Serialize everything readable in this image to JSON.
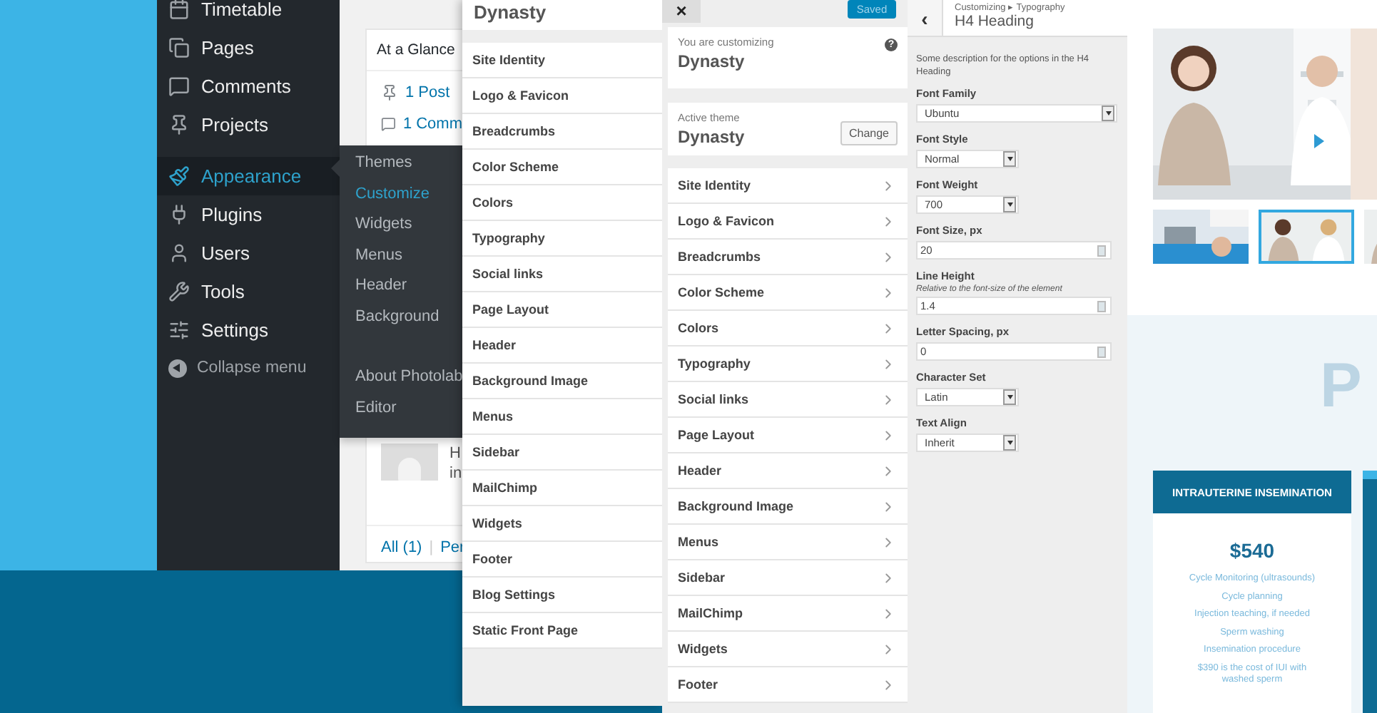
{
  "admin_menu": {
    "items": [
      {
        "label": "Timetable",
        "selected": false
      },
      {
        "label": "Pages",
        "selected": false
      },
      {
        "label": "Comments",
        "selected": false
      },
      {
        "label": "Projects",
        "selected": false
      },
      {
        "label": "Appearance",
        "selected": true
      },
      {
        "label": "Plugins",
        "selected": false
      },
      {
        "label": "Users",
        "selected": false
      },
      {
        "label": "Tools",
        "selected": false
      },
      {
        "label": "Settings",
        "selected": false
      }
    ],
    "collapse": "Collapse menu"
  },
  "submenu": {
    "items": [
      {
        "label": "Themes",
        "selected": false
      },
      {
        "label": "Customize",
        "selected": true
      },
      {
        "label": "Widgets",
        "selected": false
      },
      {
        "label": "Menus",
        "selected": false
      },
      {
        "label": "Header",
        "selected": false
      },
      {
        "label": "Background",
        "selected": false
      },
      {
        "label": "About Photolab",
        "selected": false
      },
      {
        "label": "Editor",
        "selected": false
      }
    ]
  },
  "dashboard": {
    "widget_title": "At a Glance",
    "stats": [
      "1 Post",
      "1 Comm"
    ],
    "comment_lines": [
      "H",
      "in"
    ],
    "filters": [
      "All (1)",
      "Per"
    ],
    "filter_separator": "|"
  },
  "sections_panel": {
    "title": "Dynasty",
    "items": [
      "Site Identity",
      "Logo & Favicon",
      "Breadcrumbs",
      "Color Scheme",
      "Colors",
      "Typography",
      "Social links",
      "Page Layout",
      "Header",
      "Background Image",
      "Menus",
      "Sidebar",
      "MailChimp",
      "Widgets",
      "Footer",
      "Blog Settings",
      "Static Front Page"
    ]
  },
  "customizer": {
    "close": "×",
    "save_button": "Saved",
    "customizing_label": "You are customizing",
    "site_name": "Dynasty",
    "help": "?",
    "theme_label": "Active theme",
    "theme_name": "Dynasty",
    "change_button": "Change",
    "items": [
      "Site Identity",
      "Logo & Favicon",
      "Breadcrumbs",
      "Color Scheme",
      "Colors",
      "Typography",
      "Social links",
      "Page Layout",
      "Header",
      "Background Image",
      "Menus",
      "Sidebar",
      "MailChimp",
      "Widgets",
      "Footer"
    ]
  },
  "typography_panel": {
    "back": "‹",
    "breadcrumb": "Customizing ▸ Typography",
    "title": "H4 Heading",
    "description": "Some description for the options in the H4 Heading",
    "fields": [
      {
        "label": "Font Family",
        "kind": "select",
        "value": "Ubuntu",
        "wide": true
      },
      {
        "label": "Font Style",
        "kind": "select",
        "value": "Normal",
        "wide": false
      },
      {
        "label": "Font Weight",
        "kind": "select",
        "value": "700",
        "wide": false
      },
      {
        "label": "Font Size, px",
        "kind": "number",
        "value": "20"
      },
      {
        "label": "Line Height",
        "kind": "number",
        "hint": "Relative to the font-size of the element",
        "value": "1.4"
      },
      {
        "label": "Letter Spacing, px",
        "kind": "number",
        "value": "0"
      },
      {
        "label": "Character Set",
        "kind": "select",
        "value": "Latin",
        "wide": false
      },
      {
        "label": "Text Align",
        "kind": "select",
        "value": "Inherit",
        "wide": false
      }
    ]
  },
  "preview": {
    "thumbnails": [
      {
        "selected": false
      },
      {
        "selected": true
      },
      {
        "selected": false
      }
    ],
    "heading_fragment": "P",
    "pricing": {
      "title": "INTRAUTERINE INSEMINATION",
      "price": "$540",
      "features": [
        "Cycle Monitoring (ultrasounds)",
        "Cycle planning",
        "Injection teaching, if needed",
        "Sperm washing",
        "Insemination procedure",
        "$390 is the cost of IUI with washed sperm"
      ]
    }
  }
}
